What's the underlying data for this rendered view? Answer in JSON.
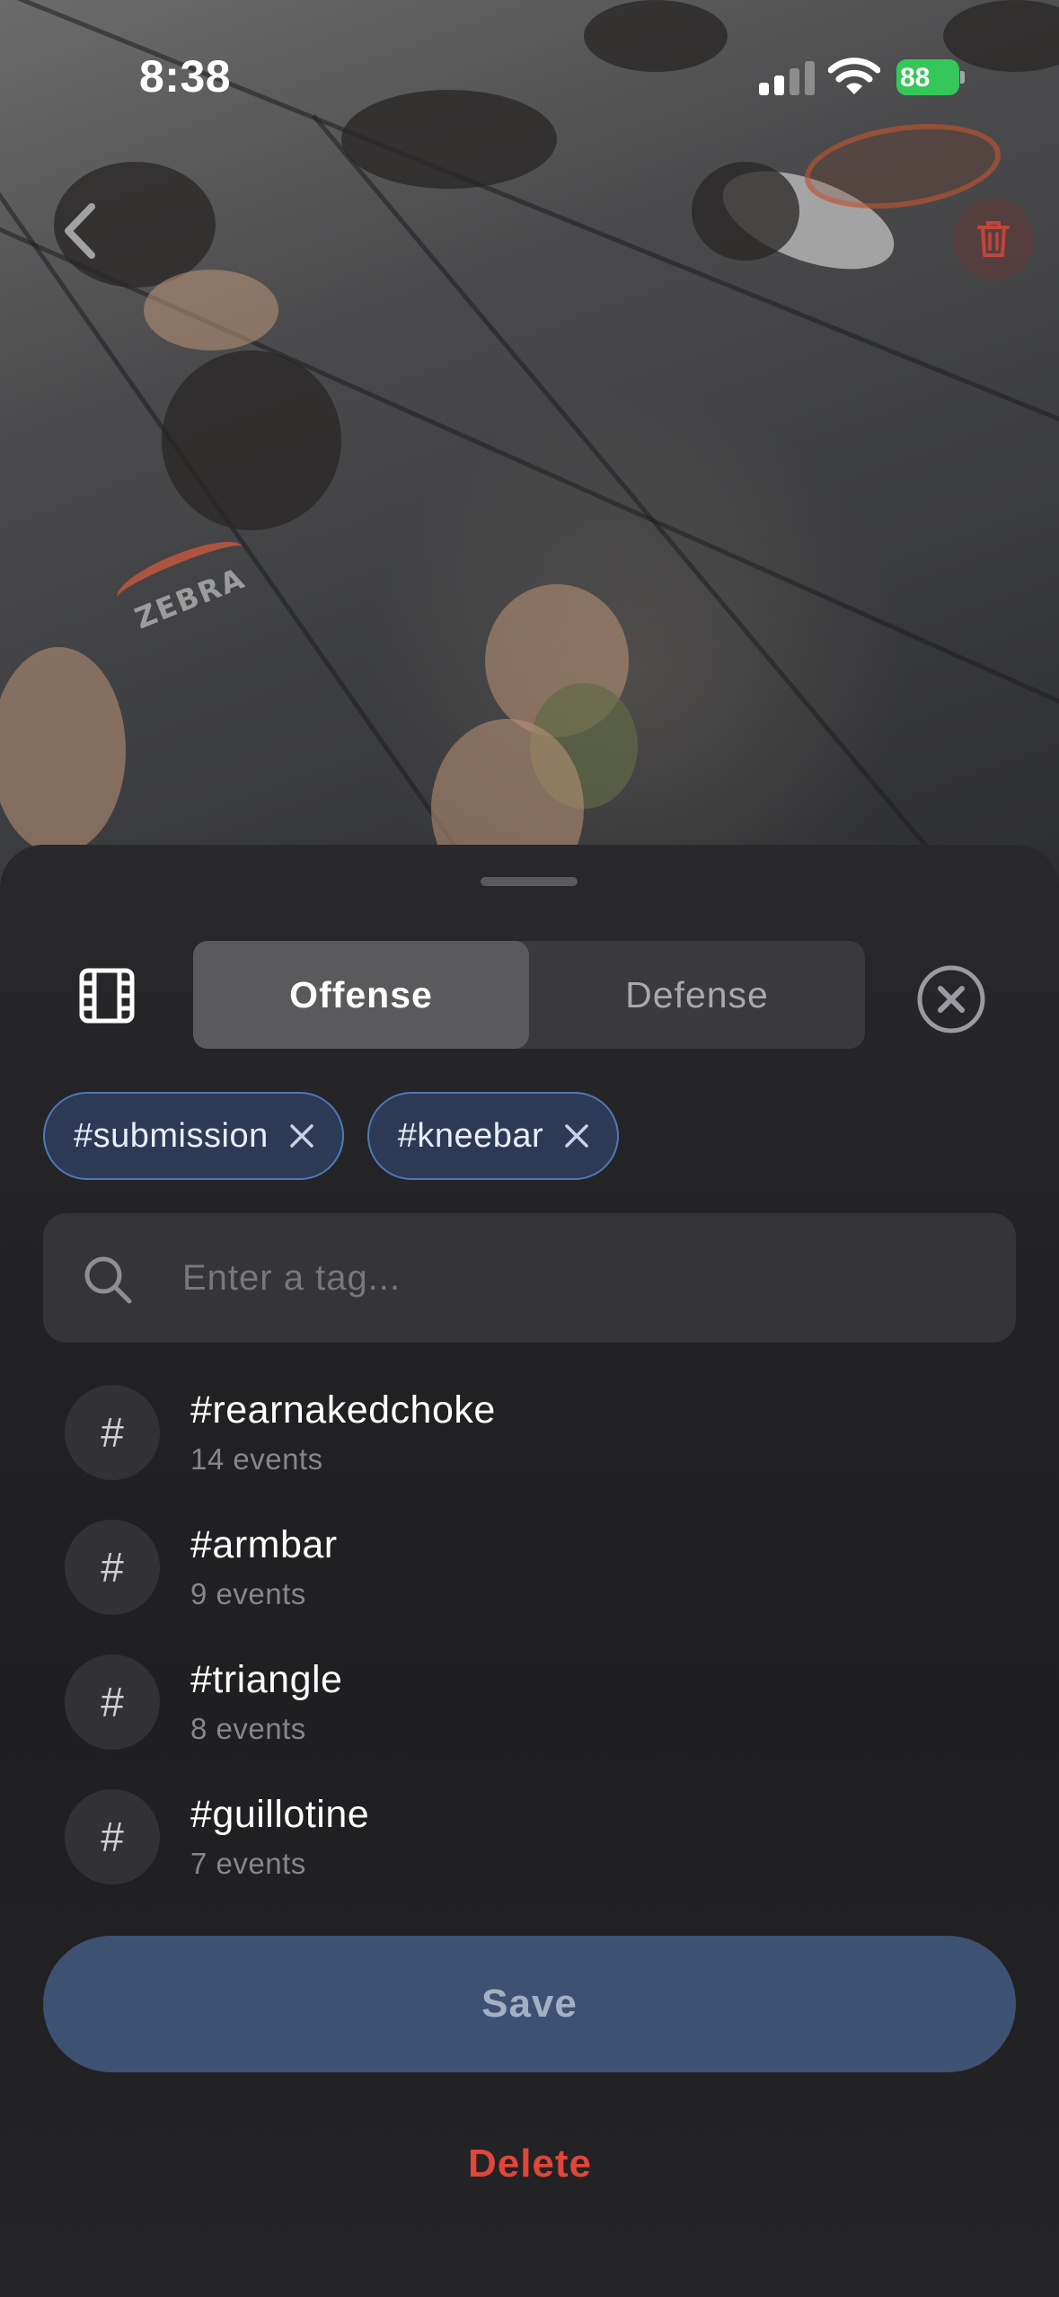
{
  "status_bar": {
    "time": "8:38",
    "battery": "88"
  },
  "icons": {
    "back": "back-chevron-icon",
    "trash": "trash-icon",
    "film": "film-icon",
    "close": "close-circle-icon",
    "search": "search-icon",
    "hash": "hash-icon"
  },
  "colors": {
    "accent_chip_border": "#4f78b8",
    "save_button": "#3d5273",
    "delete_text": "#e0463a",
    "battery": "#34c759"
  },
  "segmented": {
    "offense_label": "Offense",
    "defense_label": "Defense",
    "selected": "Offense"
  },
  "chips": [
    {
      "label": "#submission"
    },
    {
      "label": "#kneebar"
    }
  ],
  "search": {
    "placeholder": "Enter a tag...",
    "value": ""
  },
  "tags": [
    {
      "symbol": "#",
      "name": "#rearnakedchoke",
      "count": "14 events"
    },
    {
      "symbol": "#",
      "name": "#armbar",
      "count": "9 events"
    },
    {
      "symbol": "#",
      "name": "#triangle",
      "count": "8 events"
    },
    {
      "symbol": "#",
      "name": "#guillotine",
      "count": "7 events"
    }
  ],
  "actions": {
    "save_label": "Save",
    "delete_label": "Delete"
  }
}
